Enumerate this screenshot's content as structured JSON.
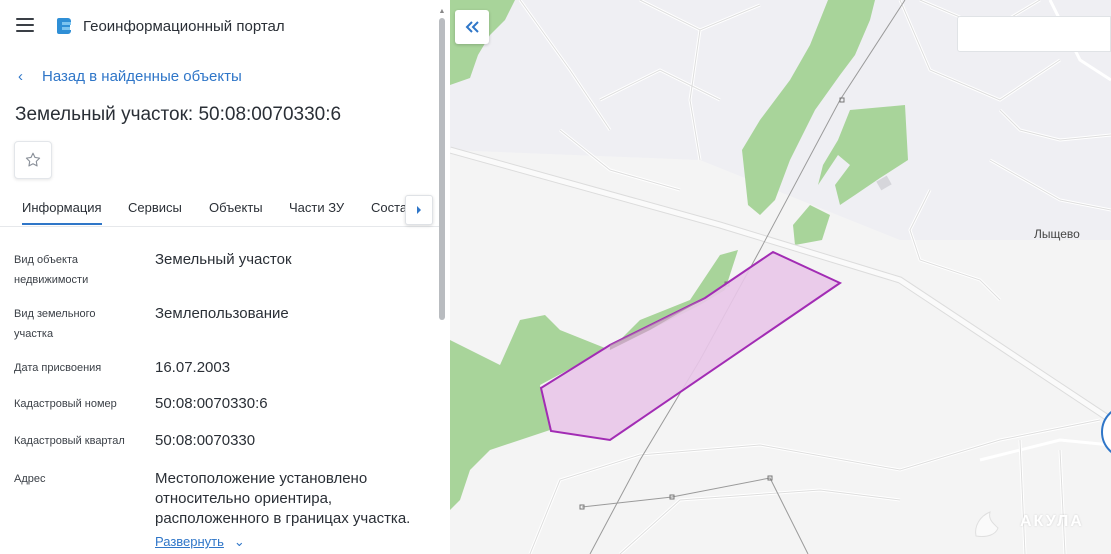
{
  "app": {
    "title": "Геоинформационный портал",
    "icons": {
      "menu": "hamburger-icon",
      "logo": "portal-logo-icon"
    }
  },
  "navigation": {
    "back_label": "Назад в найденные объекты"
  },
  "object": {
    "title": "Земельный участок: 50:08:0070330:6",
    "favorite_icon": "star-outline-icon"
  },
  "tabs": [
    {
      "label": "Информация",
      "active": true
    },
    {
      "label": "Сервисы",
      "active": false
    },
    {
      "label": "Объекты",
      "active": false
    },
    {
      "label": "Части ЗУ",
      "active": false
    },
    {
      "label": "Соста",
      "active": false
    }
  ],
  "info": [
    {
      "label": "Вид объекта недвижимости",
      "value": "Земельный участок"
    },
    {
      "label": "Вид земельного участка",
      "value": "Землепользование"
    },
    {
      "label": "Дата присвоения",
      "value": "16.07.2003"
    },
    {
      "label": "Кадастровый номер",
      "value": "50:08:0070330:6"
    },
    {
      "label": "Кадастровый квартал",
      "value": "50:08:0070330"
    },
    {
      "label": "Адрес",
      "value": "Местоположение установлено относительно ориентира, расположенного в границах участка."
    }
  ],
  "expand_label": "Развернуть",
  "map": {
    "place_label": "Лыщево",
    "watermark": "АКУЛА",
    "search_value": "",
    "colors": {
      "background": "#f4f4f4",
      "forest": "#a8d49a",
      "parcel_fill": "#e9c6e9",
      "parcel_stroke": "#a22cb4",
      "road": "#d8d8d8",
      "accent": "#2f76c8"
    }
  }
}
